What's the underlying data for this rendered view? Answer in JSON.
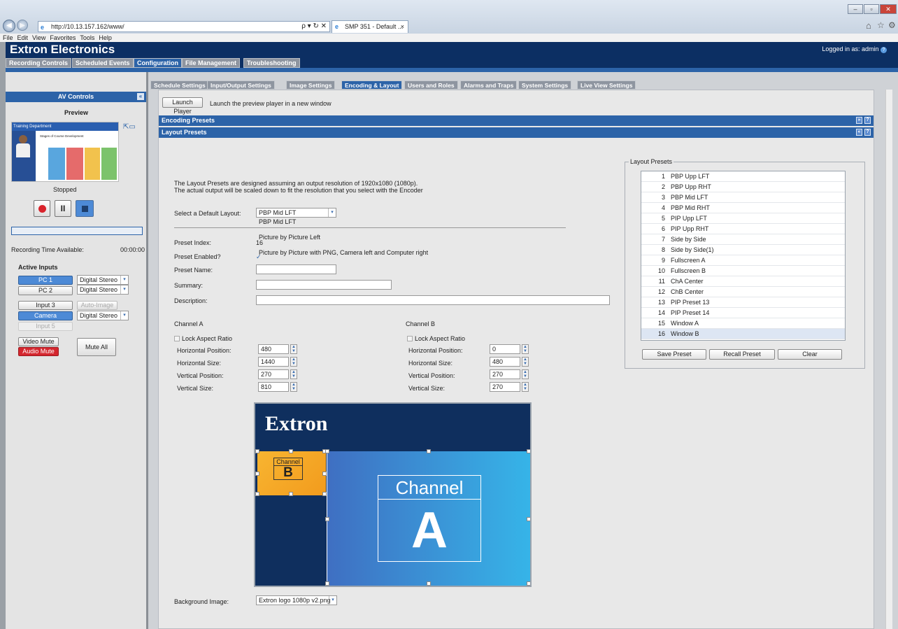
{
  "browser": {
    "url": "http://10.13.157.162/www/",
    "search_glyph": "ρ ▾ ↻ ✕",
    "tab_title": "SMP 351 - Default ...",
    "menu": [
      "File",
      "Edit",
      "View",
      "Favorites",
      "Tools",
      "Help"
    ]
  },
  "app": {
    "brand": "Extron Electronics",
    "logged_in": "Logged in as: admin",
    "main_tabs": [
      "Recording Controls",
      "Scheduled Events",
      "Configuration",
      "File Management",
      "Troubleshooting"
    ],
    "active_main_tab": "Configuration",
    "sub_tabs": [
      "Schedule Settings",
      "Input/Output Settings",
      "Image Settings",
      "Encoding & Layout",
      "Users and Roles",
      "Alarms and Traps",
      "System Settings",
      "Live View Settings"
    ],
    "active_sub_tab": "Encoding & Layout"
  },
  "av": {
    "title": "AV Controls",
    "preview_label": "Preview",
    "thumb_title": "Training Department",
    "thumb_heading": "Stages of Course Development",
    "status": "Stopped",
    "rec_time_label": "Recording Time Available:",
    "rec_time_value": "00:00:00",
    "active_inputs_label": "Active Inputs",
    "inputs": [
      {
        "name": "PC 1",
        "audio": "Digital Stereo"
      },
      {
        "name": "PC 2",
        "audio": "Digital Stereo"
      },
      {
        "name": "Input 3",
        "audio": "Auto-Image"
      },
      {
        "name": "Camera",
        "audio": "Digital Stereo"
      },
      {
        "name": "Input 5",
        "audio": ""
      }
    ],
    "video_mute": "Video Mute",
    "audio_mute": "Audio Mute",
    "mute_all": "Mute All"
  },
  "main": {
    "launch_btn": "Launch Player",
    "launch_desc": "Launch the preview player in a new window",
    "encoding_presets": "Encoding Presets",
    "layout_presets": "Layout Presets",
    "intro_line1": "The Layout Presets are designed assuming an output resolution of 1920x1080 (1080p).",
    "intro_line2": "The actual output will be scaled down to fit the resolution that you select with the Encoder",
    "default_layout_label": "Select a Default Layout:",
    "default_layout_value": "PBP Mid LFT",
    "default_layout_option": "PBP Mid LFT",
    "picture_left": "Picture by Picture Left",
    "preset_index_label": "Preset Index:",
    "preset_index_value": "16",
    "preset_enabled_label": "Preset Enabled?",
    "preset_enabled_text": "Picture by Picture with PNG, Camera left and Computer right",
    "preset_name_label": "Preset Name:",
    "summary_label": "Summary:",
    "description_label": "Description:",
    "channel_a": "Channel A",
    "channel_b": "Channel B",
    "lock_aspect": "Lock Aspect Ratio",
    "h_pos_label": "Horizontal Position:",
    "h_size_label": "Horizontal Size:",
    "v_pos_label": "Vertical Position:",
    "v_size_label": "Vertical Size:",
    "a_values": {
      "h_pos": "480",
      "h_size": "1440",
      "v_pos": "270",
      "v_size": "810"
    },
    "b_values": {
      "h_pos": "0",
      "h_size": "480",
      "v_pos": "270",
      "v_size": "270"
    },
    "canvas_logo": "Extron",
    "canvas_channel_word": "Channel",
    "canvas_a": "A",
    "canvas_b": "B",
    "bg_image_label": "Background Image:",
    "bg_image_value": "Extron logo 1080p v2.png"
  },
  "layout_list": {
    "title": "Layout Presets",
    "items": [
      {
        "n": "1",
        "name": "PBP Upp LFT"
      },
      {
        "n": "2",
        "name": "PBP Upp RHT"
      },
      {
        "n": "3",
        "name": "PBP Mid LFT"
      },
      {
        "n": "4",
        "name": "PBP Mid RHT"
      },
      {
        "n": "5",
        "name": "PIP Upp LFT"
      },
      {
        "n": "6",
        "name": "PIP Upp RHT"
      },
      {
        "n": "7",
        "name": "Side by Side"
      },
      {
        "n": "8",
        "name": "Side by Side(1)"
      },
      {
        "n": "9",
        "name": "Fullscreen A"
      },
      {
        "n": "10",
        "name": "Fullscreen B"
      },
      {
        "n": "11",
        "name": "ChA Center"
      },
      {
        "n": "12",
        "name": "ChB Center"
      },
      {
        "n": "13",
        "name": "PIP Preset 13"
      },
      {
        "n": "14",
        "name": "PIP Preset 14"
      },
      {
        "n": "15",
        "name": "Window A"
      },
      {
        "n": "16",
        "name": "Window B"
      }
    ],
    "save": "Save Preset",
    "recall": "Recall Preset",
    "clear": "Clear"
  }
}
